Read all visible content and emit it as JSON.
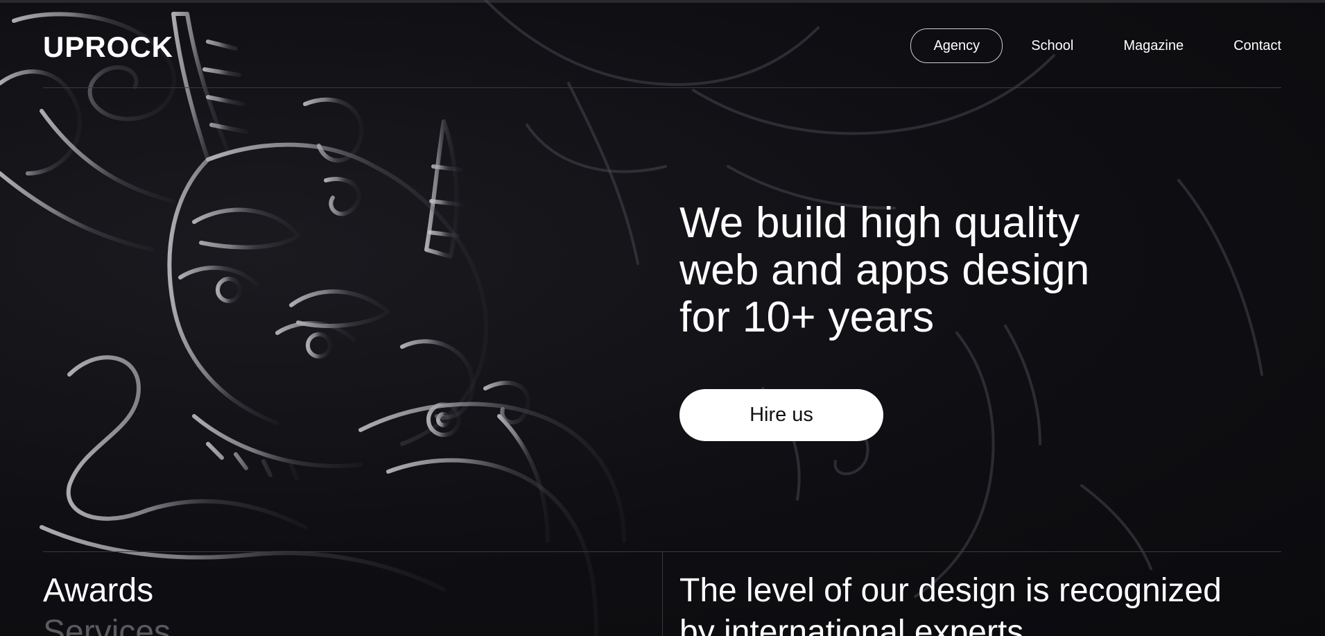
{
  "brand": {
    "logo_text": "UPROCK"
  },
  "nav": {
    "items": [
      {
        "label": "Agency",
        "active": true
      },
      {
        "label": "School",
        "active": false
      },
      {
        "label": "Magazine",
        "active": false
      },
      {
        "label": "Contact",
        "active": false
      }
    ]
  },
  "hero": {
    "title_lines": [
      "We build high quality",
      "web and apps design",
      "for 10+ years"
    ],
    "cta_label": "Hire us"
  },
  "sections": {
    "list": [
      {
        "label": "Awards",
        "active": true
      },
      {
        "label": "Services",
        "active": false
      }
    ],
    "heading_lines": [
      "The level of our design is recognized",
      "by international experts"
    ]
  },
  "colors": {
    "background": "#0e0e12",
    "text": "#ffffff",
    "muted": "#5a5a60",
    "rule": "#3a3a40",
    "button_bg": "#ffffff",
    "button_text": "#111114"
  },
  "icons": {
    "background_art": "oni-demon-mask-illustration"
  }
}
